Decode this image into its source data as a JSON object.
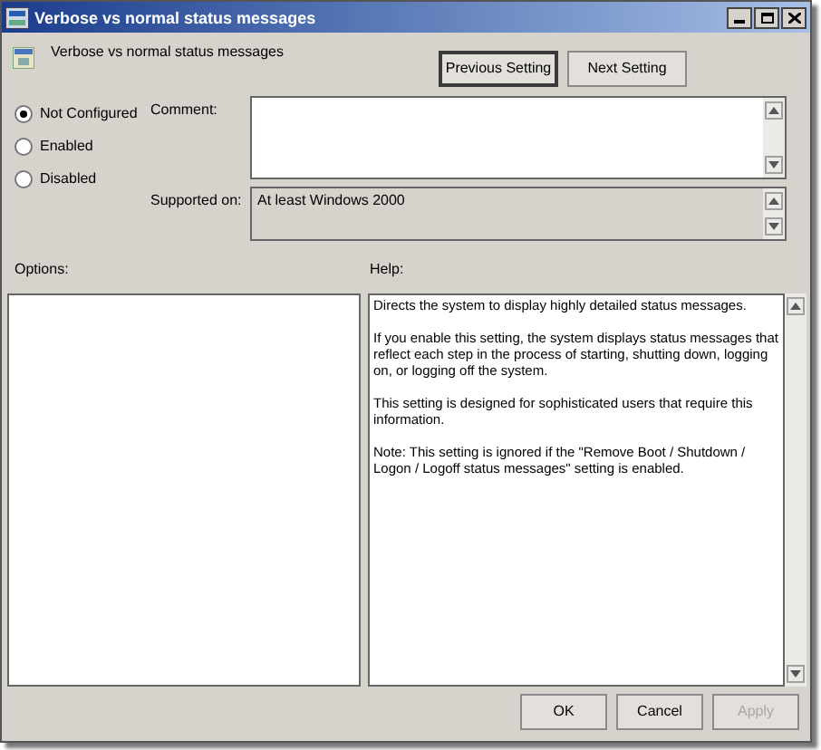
{
  "window": {
    "title": "Verbose vs normal status messages"
  },
  "setting_title": "Verbose vs normal status messages",
  "nav_buttons": [
    {
      "label": "Previous Setting",
      "selected": true
    },
    {
      "label": "Next Setting",
      "selected": false
    }
  ],
  "states": [
    {
      "label": "Not Configured",
      "selected": true
    },
    {
      "label": "Enabled",
      "selected": false
    },
    {
      "label": "Disabled",
      "selected": false
    }
  ],
  "comment": {
    "label": "Comment:"
  },
  "supported": {
    "label": "Supported on:",
    "value": "At least Windows 2000"
  },
  "options": {
    "label": "Options:"
  },
  "help": {
    "label": "Help:",
    "paragraphs": [
      "Directs the system to display highly detailed status messages.",
      "If you enable this setting, the system displays status messages that reflect each step in the process of starting, shutting down, logging on, or logging off the system.",
      "This setting is designed for sophisticated users that require this information.",
      "Note: This setting is ignored if the \"Remove Boot / Shutdown / Logon / Logoff status messages\" setting is enabled."
    ]
  },
  "buttons": [
    {
      "label": "OK",
      "disabled": false
    },
    {
      "label": "Cancel",
      "disabled": false
    },
    {
      "label": "Apply",
      "disabled": true
    }
  ]
}
